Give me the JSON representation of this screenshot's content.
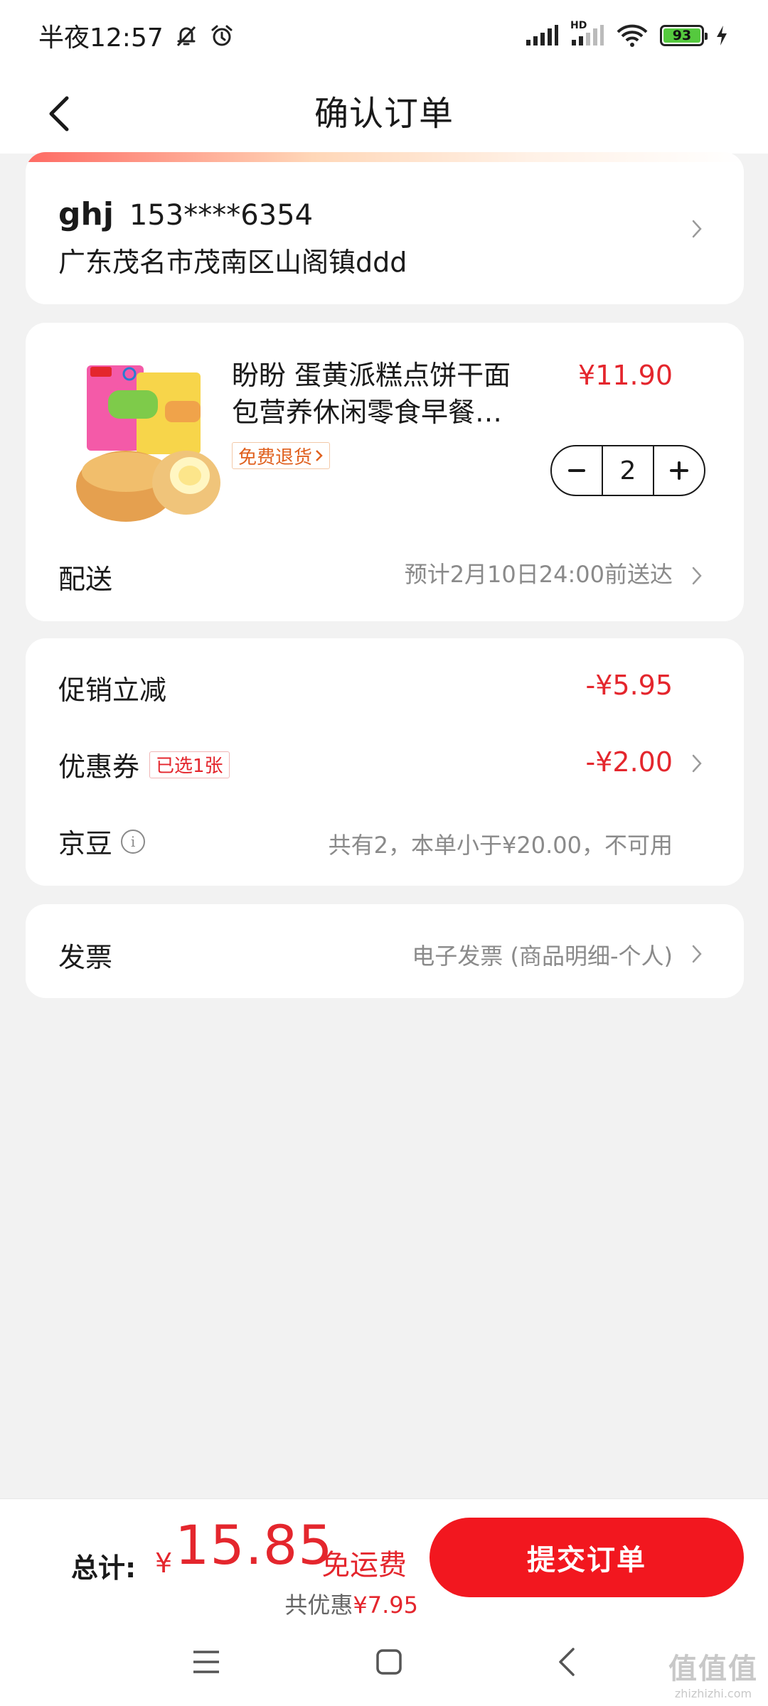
{
  "status_bar": {
    "time": "半夜12:57",
    "battery": "93",
    "network": "HD"
  },
  "header": {
    "title": "确认订单"
  },
  "address": {
    "name": "ghj",
    "phone": "153****6354",
    "detail": "广东茂名市茂南区山阁镇ddd"
  },
  "product": {
    "title_line1": "盼盼 蛋黄派糕点饼干面",
    "title_line2": "包营养休闲零食早餐…",
    "return_badge": "免费退货",
    "price": "¥11.90",
    "quantity": "2",
    "delivery_label": "配送",
    "delivery_value": "预计2月10日24:00前送达"
  },
  "discounts": {
    "promo_label": "促销立减",
    "promo_value": "-¥5.95",
    "coupon_label": "优惠券",
    "coupon_badge": "已选1张",
    "coupon_value": "-¥2.00",
    "jd_label": "京豆",
    "jd_value": "共有2，本单小于¥20.00，不可用"
  },
  "invoice": {
    "label": "发票",
    "value": "电子发票 (商品明细-个人)"
  },
  "bottom": {
    "total_label": "总计:",
    "currency": "¥",
    "total_amount": "15.85",
    "free_shipping": "免运费",
    "saved_prefix": "共优惠",
    "saved_amount": "¥7.95",
    "submit_label": "提交订单"
  },
  "watermark": {
    "big": "值值值",
    "small": "zhizhizhi.com"
  },
  "colors": {
    "accent_red": "#e4262d",
    "submit_red": "#f2171f",
    "background": "#f2f2f2",
    "badge_orange": "#e0611f"
  }
}
